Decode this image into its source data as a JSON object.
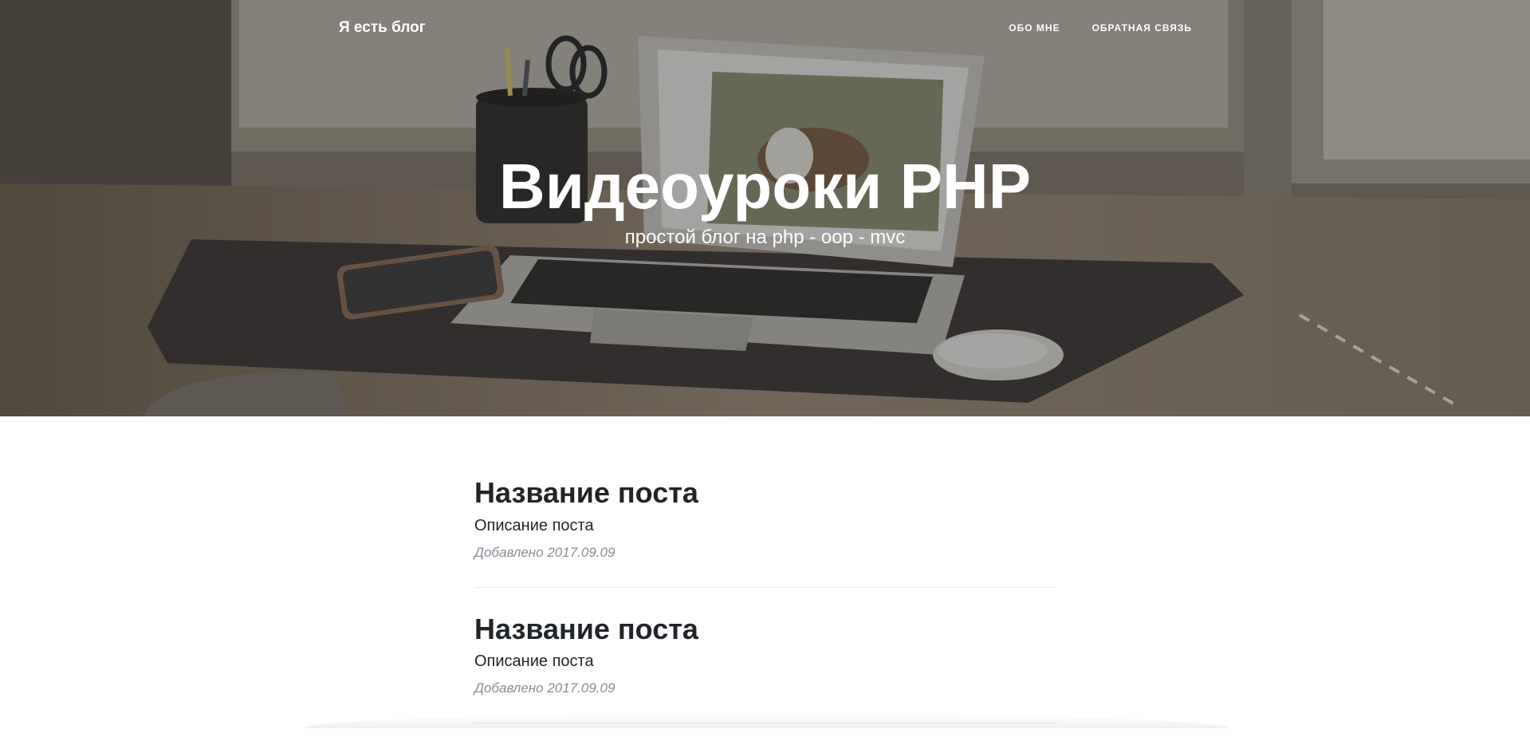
{
  "navbar": {
    "brand": "Я есть блог",
    "links": [
      {
        "label": "ОБО МНЕ"
      },
      {
        "label": "ОБРАТНАЯ СВЯЗЬ"
      }
    ]
  },
  "hero": {
    "title": "Видеоуроки PHP",
    "subtitle": "простой блог на php - oop - mvc"
  },
  "posts": [
    {
      "title": "Название поста",
      "subtitle": "Описание поста",
      "meta": "Добавлено 2017.09.09"
    },
    {
      "title": "Название поста",
      "subtitle": "Описание поста",
      "meta": "Добавлено 2017.09.09"
    }
  ]
}
